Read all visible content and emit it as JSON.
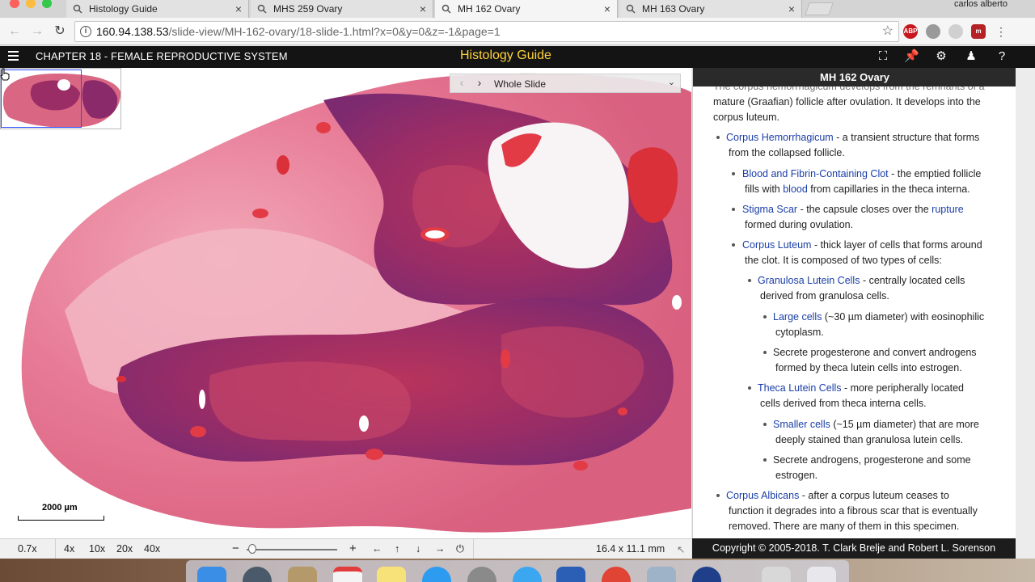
{
  "browser": {
    "tabs": [
      {
        "title": "Histology Guide",
        "active": false
      },
      {
        "title": "MHS 259 Ovary",
        "active": false
      },
      {
        "title": "MH 162 Ovary",
        "active": true
      },
      {
        "title": "MH 163 Ovary",
        "active": false
      }
    ],
    "close_glyph": "×",
    "profile_name": "carlos alberto",
    "url_host": "160.94.138.53",
    "url_path": "/slide-view/MH-162-ovary/18-slide-1.html?x=0&y=0&z=-1&page=1",
    "info_icon": "i",
    "extensions": [
      "ABP",
      "",
      "",
      "m"
    ]
  },
  "appbar": {
    "chapter": "CHAPTER 18 - FEMALE REPRODUCTIVE SYSTEM",
    "site_title": "Histology Guide",
    "icons": [
      "fullscreen-icon",
      "pin-icon",
      "gear-icon",
      "user-icon",
      "help-icon"
    ],
    "help_glyph": "?"
  },
  "viewer": {
    "slide_select": "Whole Slide",
    "scale_label": "2000 µm"
  },
  "panel": {
    "title": "MH 162 Ovary",
    "intro_partial": "The corpus hemorrhagicum develops from the remnants of a",
    "intro_1": "mature (Graafian) follicle after ovulation. It develops into the",
    "intro_2": "corpus luteum.",
    "ch_link": "Corpus Hemorrhagicum",
    "ch_text_1": " - a transient structure that forms",
    "ch_text_2": "from the collapsed follicle.",
    "bf_link": "Blood and Fibrin-Containing Clot",
    "bf_text_1": " - the emptied follicle",
    "bf_text_2a": "fills with ",
    "bf_link_2": "blood",
    "bf_text_2b": " from capillaries in the theca interna.",
    "ss_link": "Stigma Scar",
    "ss_text_1": " - the capsule closes over the ",
    "ss_link_2": "rupture",
    "ss_text_2": "formed during ovulation.",
    "cl_link": "Corpus Luteum",
    "cl_text_1": " - thick layer of cells that forms around",
    "cl_text_2": "the clot. It is composed of two types of cells:",
    "gl_link": "Granulosa Lutein Cells",
    "gl_text_1": " - centrally located cells",
    "gl_text_2": "derived from granulosa cells.",
    "lc_link": "Large cells",
    "lc_text_1": " (~30 µm diameter) with eosinophilic",
    "lc_text_2": "cytoplasm.",
    "sp_text_1": "Secrete progesterone and convert androgens",
    "sp_text_2": "formed by theca lutein cells into estrogen.",
    "tl_link": "Theca Lutein Cells",
    "tl_text_1": " - more peripherally located",
    "tl_text_2": "cells derived from theca interna cells.",
    "sc_link": "Smaller cells",
    "sc_text_1": " (~15 µm diameter) that are more",
    "sc_text_2": "deeply stained than granulosa lutein cells.",
    "sa_text_1": "Secrete androgens, progesterone and some",
    "sa_text_2": "estrogen.",
    "ca_link": "Corpus Albicans",
    "ca_text_1": " - after a corpus luteum ceases to",
    "ca_text_2": "function it degrades into a fibrous scar that is eventually",
    "ca_text_3": "removed. There are many of them in this specimen."
  },
  "status": {
    "current_zoom": "0.7x",
    "zoom_levels": [
      "4x",
      "10x",
      "20x",
      "40x"
    ],
    "minus": "−",
    "plus": "+",
    "pan_glyphs": [
      "←",
      "↑",
      "↓",
      "→"
    ],
    "home_glyph": "⏻",
    "dimensions": "16.4 x 11.1 mm",
    "corner_glyph": "↖",
    "zoom_slider_fraction": 0.05
  },
  "copyright": "Copyright © 2005-2018. T. Clark Brelje and Robert L. Sorenson",
  "colors": {
    "link": "#1a3ea8",
    "header_bg": "#141414",
    "title_accent": "#ffd33a",
    "tissue_pink": "#e05a7a",
    "tissue_purple": "#8a2a6a"
  }
}
